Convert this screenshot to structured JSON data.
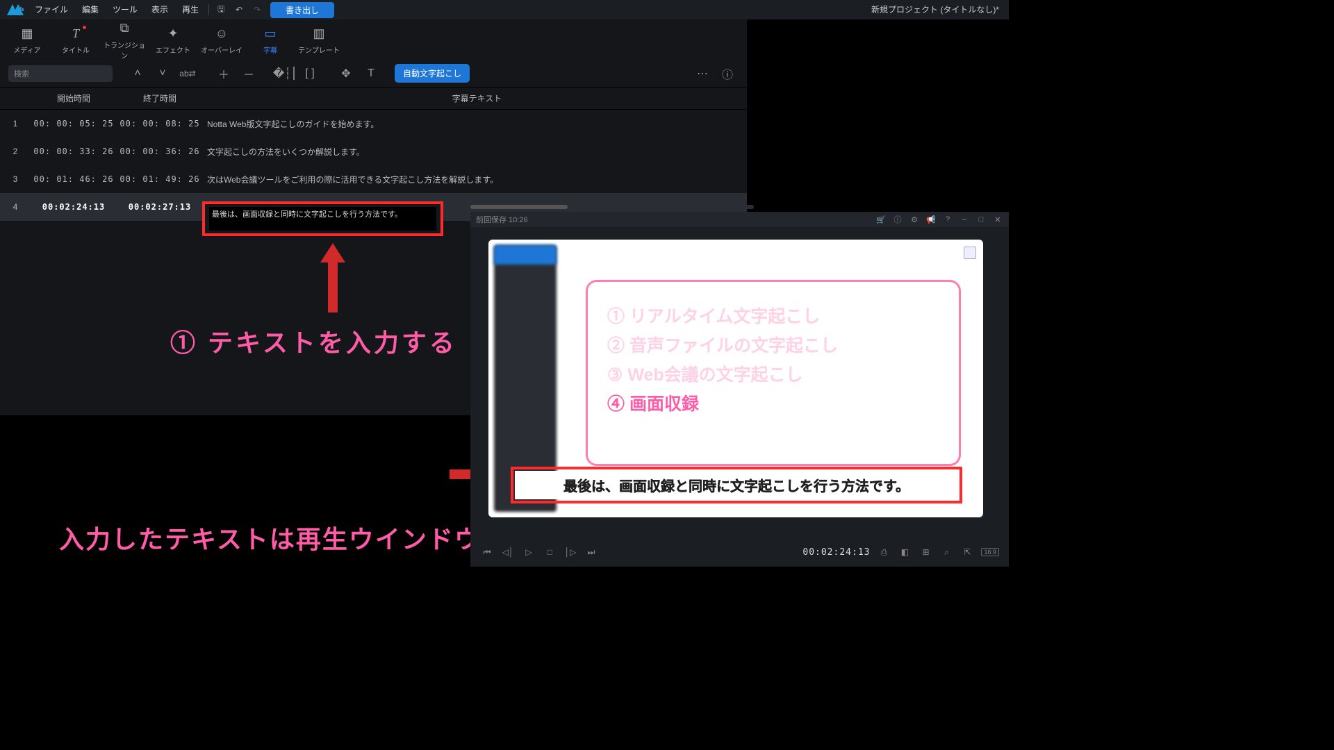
{
  "menubar": {
    "items": [
      "ファイル",
      "編集",
      "ツール",
      "表示",
      "再生"
    ],
    "export": "書き出し"
  },
  "project_title": "新規プロジェクト (タイトルなし)*",
  "modules": [
    {
      "label": "メディア",
      "icon": "media"
    },
    {
      "label": "タイトル",
      "icon": "title",
      "dot": true
    },
    {
      "label": "トランジション",
      "icon": "transition"
    },
    {
      "label": "エフェクト",
      "icon": "effect"
    },
    {
      "label": "オーバーレイ",
      "icon": "overlay"
    },
    {
      "label": "字幕",
      "icon": "subtitle",
      "active": true
    },
    {
      "label": "テンプレート",
      "icon": "template"
    }
  ],
  "search_placeholder": "検索",
  "auto_transcribe": "自動文字起こし",
  "columns": {
    "index": "",
    "start": "開始時間",
    "end": "終了時間",
    "text": "字幕テキスト"
  },
  "rows": [
    {
      "idx": "1",
      "start": "00: 00: 05: 25",
      "end": "00: 00: 08: 25",
      "text": "Notta Web版文字起こしのガイドを始めます。"
    },
    {
      "idx": "2",
      "start": "00: 00: 33: 26",
      "end": "00: 00: 36: 26",
      "text": "文字起こしの方法をいくつか解説します。"
    },
    {
      "idx": "3",
      "start": "00: 01: 46: 26",
      "end": "00: 01: 49: 26",
      "text": "次はWeb会議ツールをご利用の際に活用できる文字起こし方法を解説します。"
    },
    {
      "idx": "4",
      "start": "00:02:24:13",
      "end": "00:02:27:13",
      "text": "最後は、画面収録と同時に文字起こしを行う方法です。",
      "selected": true
    }
  ],
  "annotation1": "① テキストを入力する",
  "annotation2": "入力したテキストは再生ウインドウで字幕として確認可能",
  "preview": {
    "save_status": "前回保存 10:26",
    "card_lines": [
      "① リアルタイム文字起こし",
      "② 音声ファイルの文字起こし",
      "③ Web会議の文字起こし",
      "④ 画面収録"
    ],
    "subtitle_overlay": "最後は、画面収録と同時に文字起こしを行う方法です。",
    "timecode": "00:02:24:13",
    "aspect": "16:9"
  }
}
